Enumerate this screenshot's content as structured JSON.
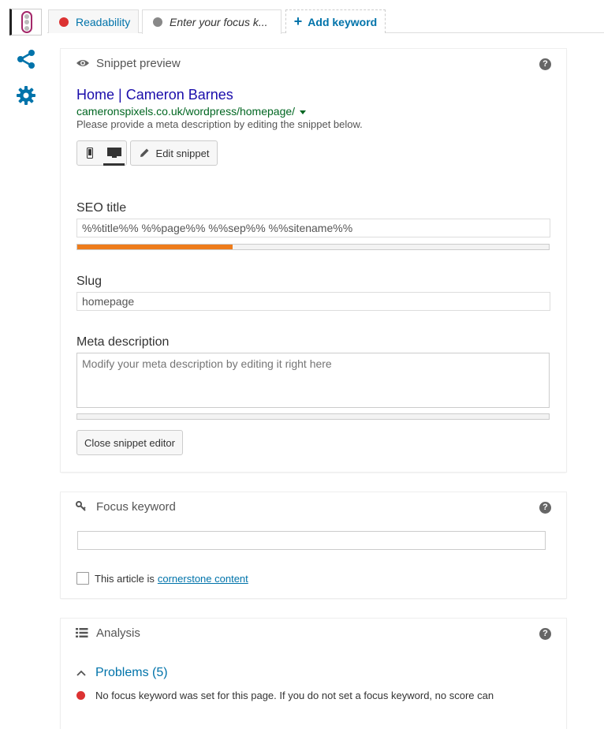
{
  "tabs": [
    {
      "label": "Readability",
      "dot_color": "#dc3232"
    },
    {
      "label": "Enter your focus k...",
      "dot_color": "#888888"
    },
    {
      "label": "Add keyword"
    }
  ],
  "colors": {
    "accent": "#0073aa",
    "problem": "#dc3232",
    "meter": "#ee7c1b",
    "serp_title": "#1a0dab",
    "serp_url": "#006621"
  },
  "snippet": {
    "header": "Snippet preview",
    "title": "Home | Cameron Barnes",
    "url": "cameronspixels.co.uk/wordpress/homepage/",
    "hint": "Please provide a meta description by editing the snippet below.",
    "edit_label": "Edit snippet",
    "seo_title_label": "SEO title",
    "seo_title_value": "%%title%% %%page%% %%sep%% %%sitename%%",
    "seo_title_progress": 0.33,
    "slug_label": "Slug",
    "slug_value": "homepage",
    "meta_label": "Meta description",
    "meta_placeholder": "Modify your meta description by editing it right here",
    "meta_progress": 0,
    "close_label": "Close snippet editor"
  },
  "focus": {
    "header": "Focus keyword",
    "value": "",
    "cornerstone_text": "This article is",
    "cornerstone_link": "cornerstone content"
  },
  "analysis": {
    "header": "Analysis",
    "problems_label": "Problems (5)",
    "problems": [
      "No focus keyword was set for this page. If you do not set a focus keyword, no score can"
    ]
  },
  "help_label": "?",
  "icons": [
    "traffic-light-icon",
    "share-icon",
    "gear-icon",
    "eye-icon",
    "key-icon",
    "list-icon",
    "mobile-icon",
    "desktop-icon",
    "pencil-icon",
    "help-icon",
    "chevron-up-icon"
  ]
}
